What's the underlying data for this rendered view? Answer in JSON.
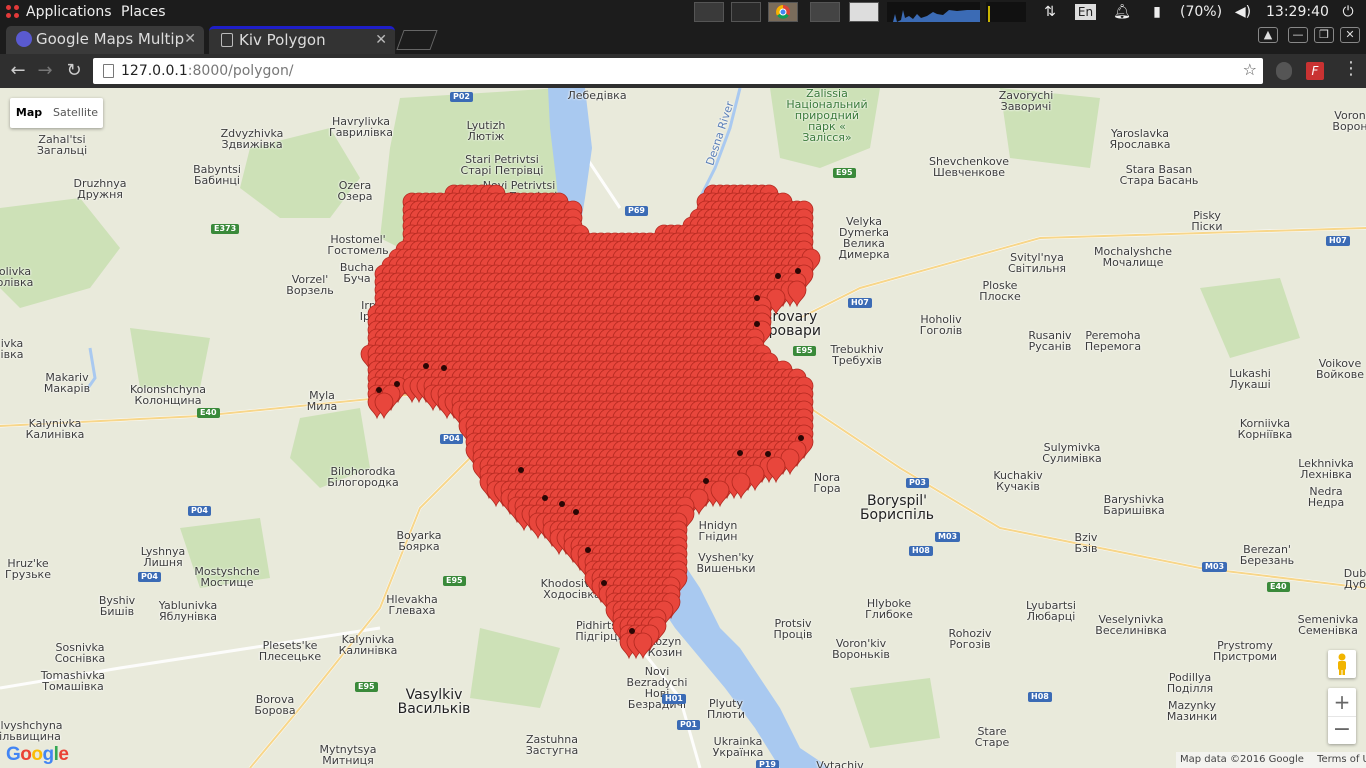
{
  "panel": {
    "applications_label": "Applications",
    "places_label": "Places",
    "lang": "En",
    "battery": "(70%)",
    "clock": "13:29:40"
  },
  "tabs": [
    {
      "title": "Google Maps Multip"
    },
    {
      "title": "Kiv Polygon"
    }
  ],
  "omnibox": {
    "host": "127.0.0.1",
    "path": ":8000/polygon/"
  },
  "map_controls": {
    "map_label": "Map",
    "satellite_label": "Satellite",
    "zoom_in": "+",
    "zoom_out": "−"
  },
  "attribution": {
    "map_data": "Map data ©2016 Google",
    "terms": "Terms of Use"
  },
  "logo": "Google",
  "colors": {
    "marker_fill": "#e8463c",
    "marker_stroke": "#b2281f",
    "water": "#a9c9f0",
    "forest": "#cde1b7",
    "land": "#e9eadb"
  },
  "places": [
    {
      "name": "Лебедівка"
    },
    {
      "name": "Lyutizh\nЛютіж"
    },
    {
      "name": "Stari Petrivtsi\nСтарі Петрівці"
    },
    {
      "name": "Novi Petrivtsi\nНові Петрівці"
    },
    {
      "name": "Havrylivka\nГаврилівка"
    },
    {
      "name": "Zdvyzhivka\nЗдвижівка"
    },
    {
      "name": "Zahal'tsi\nЗагальці"
    },
    {
      "name": "Babyntsi\nБабинці"
    },
    {
      "name": "Druzhnya\nДружня"
    },
    {
      "name": "Ozera\nОзера"
    },
    {
      "name": "Hostomel'\nГостомель"
    },
    {
      "name": "Bucha\nБуча"
    },
    {
      "name": "Vorzel'\nВорзель"
    },
    {
      "name": "olivka\nолівка"
    },
    {
      "name": "ivka\nівка"
    },
    {
      "name": "Makariv\nМакарів"
    },
    {
      "name": "Kolonshchyna\nКолонщина"
    },
    {
      "name": "Myla\nМила"
    },
    {
      "name": "Kalynivka\nКалинівка"
    },
    {
      "name": "Bilohorodka\nБілогородка"
    },
    {
      "name": "Boyarka\nБоярка"
    },
    {
      "name": "Lyshnya\nЛишня"
    },
    {
      "name": "Mostyshche\nМостище"
    },
    {
      "name": "Hruz'ke\nГрузьке"
    },
    {
      "name": "Byshiv\nБишів"
    },
    {
      "name": "Yablunivka\nЯблунівка"
    },
    {
      "name": "Hlevakha\nГлеваха"
    },
    {
      "name": "Sosnivka\nСоснівка"
    },
    {
      "name": "Plesets'ke\nПлесецьке"
    },
    {
      "name": "Kalynivka\nКалинівка"
    },
    {
      "name": "Tomashivka\nТомашівка"
    },
    {
      "name": "Borova\nБорова"
    },
    {
      "name": "Vasylkiv\nВасильків"
    },
    {
      "name": "ilvyshchyna\nільвищина"
    },
    {
      "name": "Mytnytsya\nМитниця"
    },
    {
      "name": "Zastuhna\nЗастугна"
    },
    {
      "name": "Khodosivka\nХодосівка"
    },
    {
      "name": "Pidhirtsi\nПідгірці"
    },
    {
      "name": "Novi\nBezradychi\nНові\nБезрадичі"
    },
    {
      "name": "Plyuty\nПлюти"
    },
    {
      "name": "Ukrainka\nУкраїнка"
    },
    {
      "name": "Vytachiv"
    },
    {
      "name": "Hnidyn\nГнідин"
    },
    {
      "name": "Vyshen'ky\nВишеньки"
    },
    {
      "name": "Protsiv\nПроців"
    },
    {
      "name": "Voron'kiv\nВороньків"
    },
    {
      "name": "Hlyboke\nГлибоке"
    },
    {
      "name": "Rohoziv\nРогозів"
    },
    {
      "name": "Stare\nСтаре"
    },
    {
      "name": "Nora\nГора"
    },
    {
      "name": "Boryspil'\nБориспіль"
    },
    {
      "name": "Kuchakiv\nКучаків"
    },
    {
      "name": "Sulymivka\nСулимівка"
    },
    {
      "name": "Baryshivka\nБаришівка"
    },
    {
      "name": "Bziv\nБзів"
    },
    {
      "name": "Berezan'\nБерезань"
    },
    {
      "name": "Lyubartsi\nЛюбарці"
    },
    {
      "name": "Veselynivka\nВеселинівка"
    },
    {
      "name": "Semenivka\nСеменівка"
    },
    {
      "name": "Prystromy\nПристроми"
    },
    {
      "name": "Podillya\nПоділля"
    },
    {
      "name": "Mazynky\nМазинки"
    },
    {
      "name": "Lekhnivka\nЛехнівка"
    },
    {
      "name": "Nedra\nНедра"
    },
    {
      "name": "Korniivka\nКорніївка"
    },
    {
      "name": "Lukashi\nЛукаші"
    },
    {
      "name": "Voikove\nВойкове"
    },
    {
      "name": "Rusaniv\nРусанів"
    },
    {
      "name": "Peremoha\nПеремога"
    },
    {
      "name": "Hoholiv\nГоголів"
    },
    {
      "name": "Trebukhiv\nТребухів"
    },
    {
      "name": "Ploske\nПлоске"
    },
    {
      "name": "Svityl'nya\nСвітильня"
    },
    {
      "name": "Mochalyshche\nМочалище"
    },
    {
      "name": "Pisky\nПіски"
    },
    {
      "name": "Stara Basan\nСтара Басань"
    },
    {
      "name": "Yaroslavka\nЯрославка"
    },
    {
      "name": "Shevchenkove\nШевченкове"
    },
    {
      "name": "Zavorychi\nЗаворичі"
    },
    {
      "name": "Velyka\nDymerka\nВелика\nДимерка"
    },
    {
      "name": "Zalissia\nНаціональний\nприродний\nпарк «\nЗалісся»"
    },
    {
      "name": "Desna River"
    },
    {
      "name": "Voron\nВорон"
    },
    {
      "name": "Dub\nДуб"
    },
    {
      "name": "Irpi\nIрпі"
    },
    {
      "name": "Brovary\nБровари"
    },
    {
      "name": "Kozyn\nКозин"
    }
  ],
  "road_shields": [
    {
      "label": "P02"
    },
    {
      "label": "P69"
    },
    {
      "label": "E95"
    },
    {
      "label": "E373"
    },
    {
      "label": "H07"
    },
    {
      "label": "H07"
    },
    {
      "label": "E95"
    },
    {
      "label": "E40"
    },
    {
      "label": "P04"
    },
    {
      "label": "P04"
    },
    {
      "label": "P04"
    },
    {
      "label": "E95"
    },
    {
      "label": "P03"
    },
    {
      "label": "M03"
    },
    {
      "label": "H08"
    },
    {
      "label": "M03"
    },
    {
      "label": "E40"
    },
    {
      "label": "E95"
    },
    {
      "label": "H01"
    },
    {
      "label": "P01"
    },
    {
      "label": "H08"
    },
    {
      "label": "P19"
    }
  ]
}
